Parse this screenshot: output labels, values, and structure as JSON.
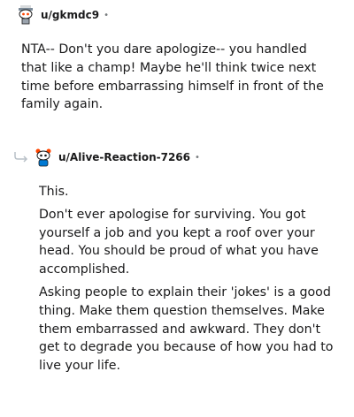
{
  "comments": [
    {
      "username": "u/gkmdc9",
      "separator": "•",
      "avatar_icon": "snoo-avatar-icon",
      "paragraphs": [
        "NTA-- Don't you dare apologize-- you handled that like a champ! Maybe he'll think twice next time before embarrassing himself in front of the family again."
      ]
    },
    {
      "username": "u/Alive-Reaction-7266",
      "separator": "•",
      "avatar_icon": "snoo-avatar-icon",
      "reply_icon": "reply-arrow-icon",
      "paragraphs": [
        "This.",
        "Don't ever apologise for surviving. You got yourself a job and you kept a roof over your head. You should be proud of what you have accomplished.",
        "Asking people to explain their 'jokes' is a good thing. Make them question themselves. Make them embarrassed and awkward. They don't get to degrade you because of how you had to live your life."
      ]
    }
  ]
}
